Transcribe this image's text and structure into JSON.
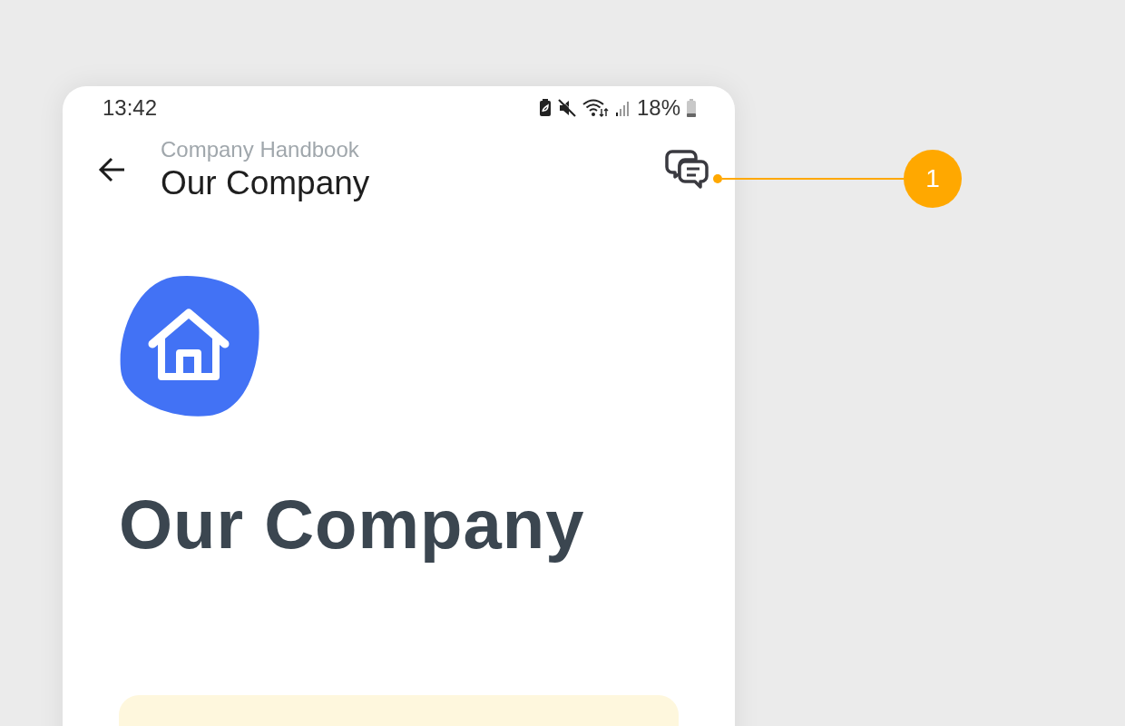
{
  "status_bar": {
    "time": "13:42",
    "battery": "18%"
  },
  "header": {
    "subtitle": "Company Handbook",
    "title": "Our Company"
  },
  "page": {
    "title": "Our Company"
  },
  "callouts": [
    {
      "number": "1"
    }
  ]
}
